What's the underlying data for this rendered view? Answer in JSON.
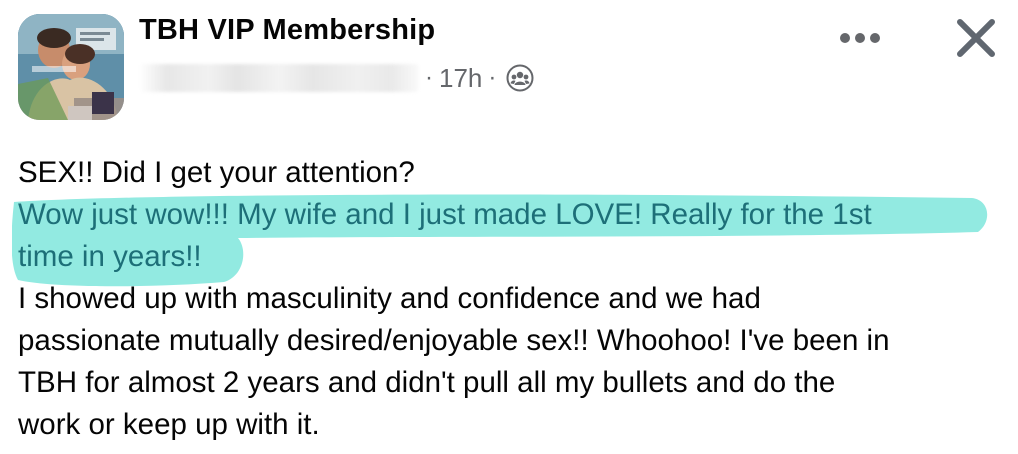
{
  "header": {
    "group_name": "TBH VIP Membership",
    "separator": "·",
    "timestamp": "17h",
    "separator2": "·",
    "audience_icon": "group-icon"
  },
  "controls": {
    "more_icon": "more-horizontal-icon",
    "close_icon": "close-icon"
  },
  "post": {
    "lines": [
      "SEX!! Did I get your attention?",
      "Wow just wow!!! My wife and I just made LOVE! Really for the 1st",
      "time in years!!",
      "I showed up with masculinity and confidence and we had",
      "passionate mutually desired/enjoyable sex!! Whoohoo! I've been in",
      "TBH for almost 2 years and didn't pull all my bullets and do the",
      "work or keep up with it."
    ]
  },
  "colors": {
    "highlight": "#7fe6dc",
    "text": "#050505",
    "meta": "#65676b"
  }
}
